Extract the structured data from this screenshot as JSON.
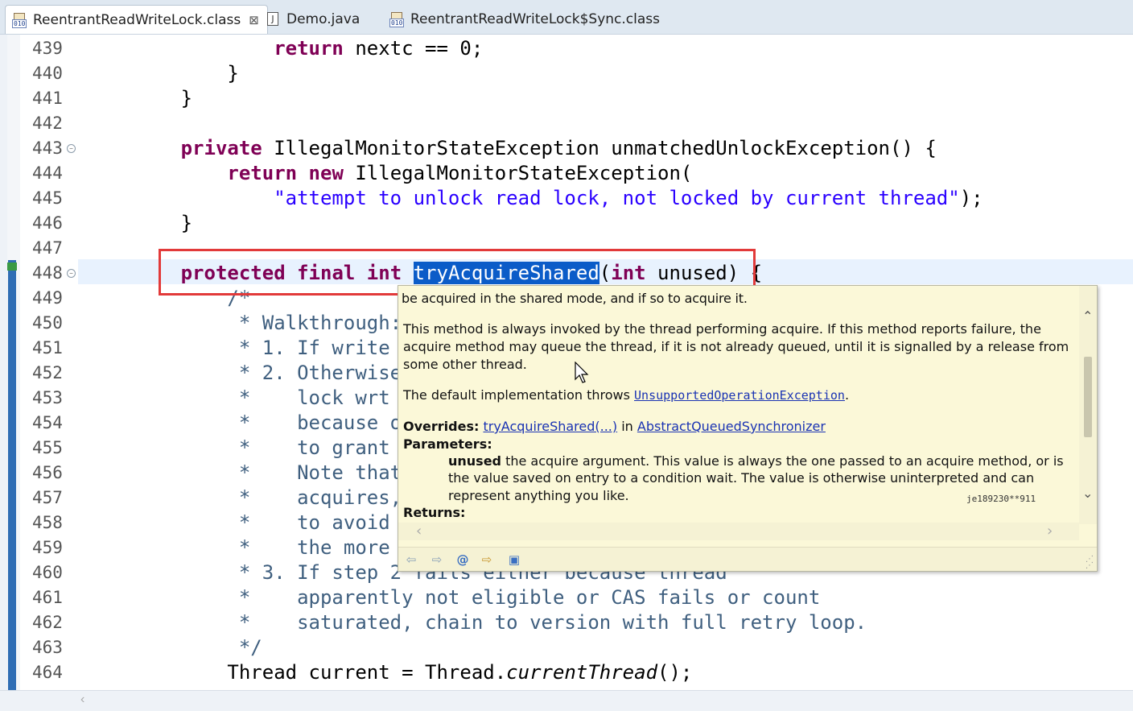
{
  "tabs": [
    {
      "label": "ReentrantReadWriteLock.class",
      "icon": "class-file-icon",
      "active": true
    },
    {
      "label": "Demo.java",
      "icon": "java-file-icon",
      "active": false
    },
    {
      "label": "ReentrantReadWriteLock$Sync.class",
      "icon": "class-file-icon",
      "active": false
    }
  ],
  "tab_close_glyph": "⊠",
  "class_icon_bits": "010",
  "java_icon_letter": "J",
  "lines": [
    {
      "n": "439",
      "tokens": [
        {
          "t": "                ",
          "c": "plain"
        },
        {
          "t": "return",
          "c": "kw"
        },
        {
          "t": " nextc == 0;",
          "c": "plain"
        }
      ]
    },
    {
      "n": "440",
      "tokens": [
        {
          "t": "            }",
          "c": "plain"
        }
      ]
    },
    {
      "n": "441",
      "tokens": [
        {
          "t": "        }",
          "c": "plain"
        }
      ]
    },
    {
      "n": "442",
      "tokens": []
    },
    {
      "n": "443",
      "fold": true,
      "tokens": [
        {
          "t": "        ",
          "c": "plain"
        },
        {
          "t": "private",
          "c": "kw"
        },
        {
          "t": " IllegalMonitorStateException unmatchedUnlockException() {",
          "c": "plain"
        }
      ]
    },
    {
      "n": "444",
      "tokens": [
        {
          "t": "            ",
          "c": "plain"
        },
        {
          "t": "return",
          "c": "kw"
        },
        {
          "t": " ",
          "c": "plain"
        },
        {
          "t": "new",
          "c": "kw"
        },
        {
          "t": " IllegalMonitorStateException(",
          "c": "plain"
        }
      ]
    },
    {
      "n": "445",
      "tokens": [
        {
          "t": "                ",
          "c": "plain"
        },
        {
          "t": "\"attempt to unlock read lock, not locked by current thread\"",
          "c": "str"
        },
        {
          "t": ");",
          "c": "plain"
        }
      ]
    },
    {
      "n": "446",
      "tokens": [
        {
          "t": "        }",
          "c": "plain"
        }
      ]
    },
    {
      "n": "447",
      "tokens": []
    },
    {
      "n": "448",
      "fold": true,
      "current": true,
      "tokens": [
        {
          "t": "        ",
          "c": "plain"
        },
        {
          "t": "protected",
          "c": "kw"
        },
        {
          "t": " ",
          "c": "plain"
        },
        {
          "t": "final",
          "c": "kw"
        },
        {
          "t": " ",
          "c": "plain"
        },
        {
          "t": "int",
          "c": "kw"
        },
        {
          "t": " ",
          "c": "plain"
        },
        {
          "t": "tryAcquireShared",
          "c": "sel"
        },
        {
          "t": "(",
          "c": "plain"
        },
        {
          "t": "int",
          "c": "kw"
        },
        {
          "t": " unused) {",
          "c": "plain"
        }
      ]
    },
    {
      "n": "449",
      "tokens": [
        {
          "t": "            /*",
          "c": "cm"
        }
      ]
    },
    {
      "n": "450",
      "tokens": [
        {
          "t": "             * Walkthrough:",
          "c": "cm"
        }
      ]
    },
    {
      "n": "451",
      "tokens": [
        {
          "t": "             * 1. If write l",
          "c": "cm"
        }
      ]
    },
    {
      "n": "452",
      "tokens": [
        {
          "t": "             * 2. Otherwise,",
          "c": "cm"
        }
      ]
    },
    {
      "n": "453",
      "tokens": [
        {
          "t": "             *    lock wrt s",
          "c": "cm"
        }
      ]
    },
    {
      "n": "454",
      "tokens": [
        {
          "t": "             *    because of",
          "c": "cm"
        }
      ]
    },
    {
      "n": "455",
      "tokens": [
        {
          "t": "             *    to grant b",
          "c": "cm"
        }
      ]
    },
    {
      "n": "456",
      "tokens": [
        {
          "t": "             *    Note that",
          "c": "cm"
        }
      ]
    },
    {
      "n": "457",
      "tokens": [
        {
          "t": "             *    acquires,",
          "c": "cm"
        }
      ]
    },
    {
      "n": "458",
      "tokens": [
        {
          "t": "             *    to avoid h",
          "c": "cm"
        }
      ]
    },
    {
      "n": "459",
      "tokens": [
        {
          "t": "             *    the more t",
          "c": "cm"
        }
      ]
    },
    {
      "n": "460",
      "tokens": [
        {
          "t": "             * 3. If step 2 fails either because thread",
          "c": "cm"
        }
      ]
    },
    {
      "n": "461",
      "tokens": [
        {
          "t": "             *    apparently not eligible or CAS fails or count",
          "c": "cm"
        }
      ]
    },
    {
      "n": "462",
      "tokens": [
        {
          "t": "             *    saturated, chain to version with full retry loop.",
          "c": "cm"
        }
      ]
    },
    {
      "n": "463",
      "tokens": [
        {
          "t": "             */",
          "c": "cm"
        }
      ]
    },
    {
      "n": "464",
      "tokens": [
        {
          "t": "            Thread current = Thread.",
          "c": "plain"
        },
        {
          "t": "currentThread",
          "c": "it"
        },
        {
          "t": "();",
          "c": "plain"
        }
      ]
    }
  ],
  "hover": {
    "top_cut_line": "be acquired in the shared mode, and if so to acquire it.",
    "para1_l1": "This method is always invoked by the thread performing acquire. If this method reports failure, the",
    "para1_l2": "acquire method may queue the thread, if it is not already queued, until it is signalled by a release from",
    "para1_l3": "some other thread.",
    "default_prefix": "The default implementation throws ",
    "default_link": "UnsupportedOperationException",
    "default_suffix": ".",
    "overrides_label": "Overrides:",
    "overrides_method": "tryAcquireShared(...)",
    "overrides_in": " in ",
    "overrides_class": "AbstractQueuedSynchronizer",
    "parameters_label": "Parameters:",
    "param_name": "unused",
    "param_l1": " the acquire argument. This value is always the one passed to an acquire method, or is",
    "param_l2": "the value saved on entry to a condition wait. The value is otherwise uninterpreted and can",
    "param_l3": "represent anything you like.",
    "returns_label": "Returns:",
    "watermark": "je189230**911"
  },
  "hover_toolbar_icons": [
    "back-icon",
    "forward-icon",
    "javadoc-at-icon",
    "open-declaration-icon",
    "open-external-browser-icon"
  ]
}
